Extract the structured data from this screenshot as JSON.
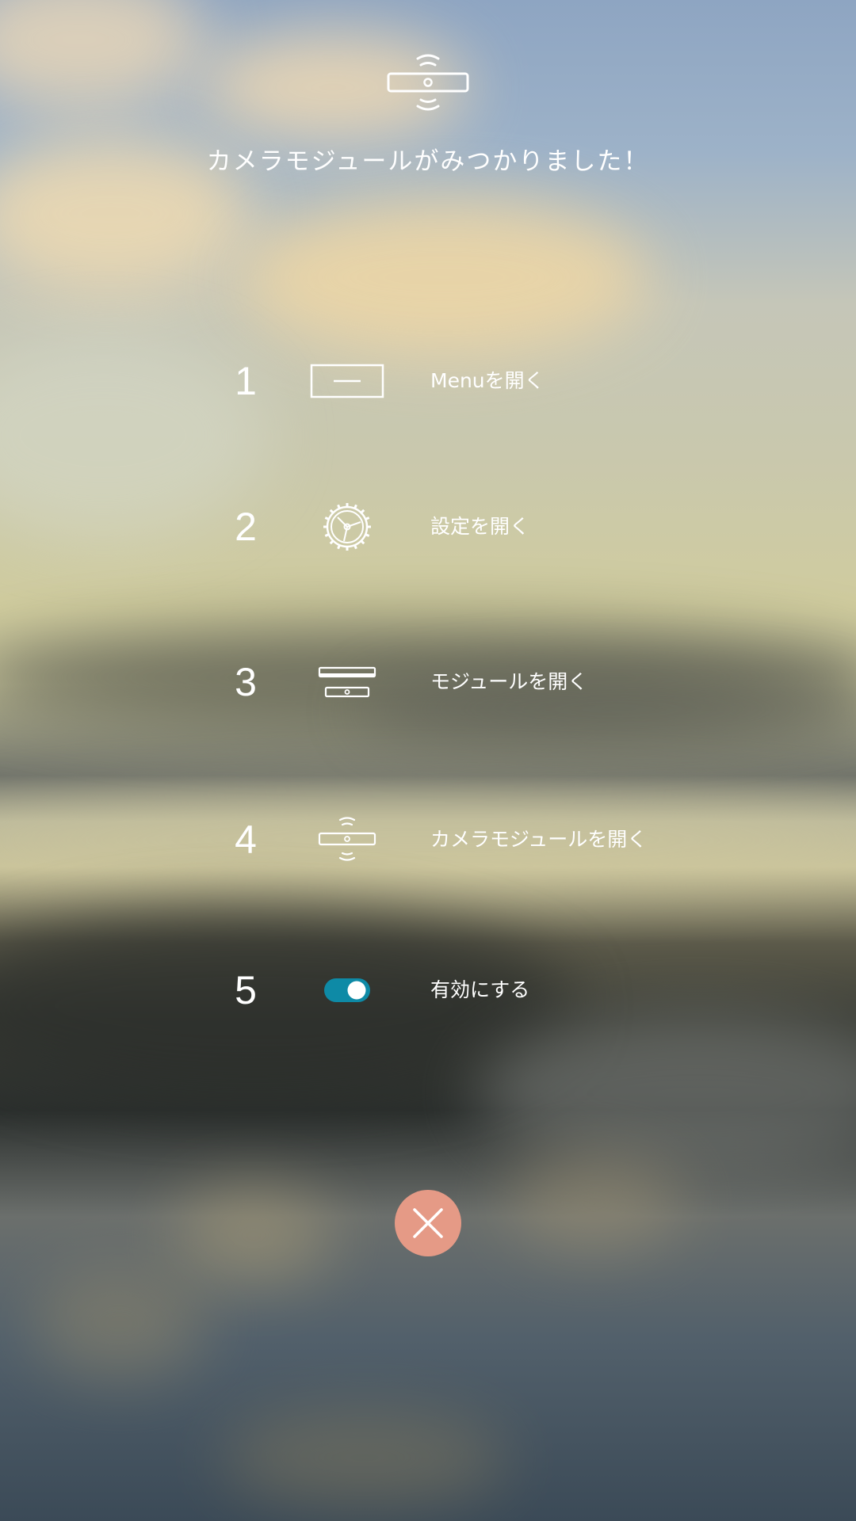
{
  "header": {
    "icon": "camera-module-icon",
    "title": "カメラモジュールがみつかりました！"
  },
  "steps": [
    {
      "number": "1",
      "icon": "menu-icon",
      "label": "Menuを開く"
    },
    {
      "number": "2",
      "icon": "gear-icon",
      "label": "設定を開く"
    },
    {
      "number": "3",
      "icon": "module-icon",
      "label": "モジュールを開く"
    },
    {
      "number": "4",
      "icon": "camera-module-icon",
      "label": "カメラモジュールを開く"
    },
    {
      "number": "5",
      "icon": "toggle-on-icon",
      "label": "有効にする",
      "toggle_state": "on"
    }
  ],
  "close_button": {
    "icon": "close-icon"
  },
  "colors": {
    "toggle_track": "#0e8aa6",
    "close_button_bg": "#e59a86",
    "text": "#ffffff"
  }
}
